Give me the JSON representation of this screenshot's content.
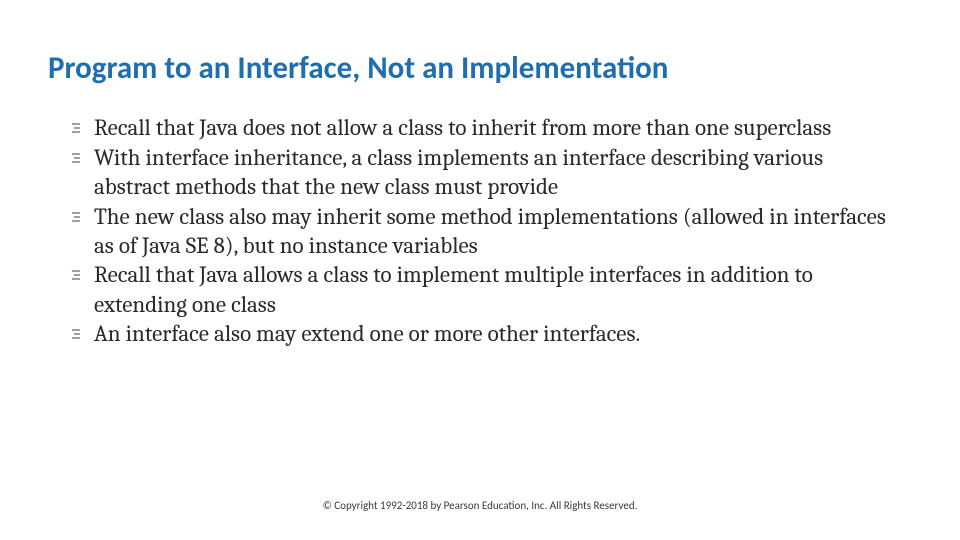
{
  "title": "Program to an Interface, Not an Implementation",
  "bullets": {
    "b0": "Recall that Java does not allow a class to inherit from more than one superclass",
    "b1": "With interface inheritance, a class implements an interface describing various abstract methods that the new class must provide",
    "b2": "The new class also may inherit some method implementations (allowed in interfaces as of Java SE 8), but no instance variables",
    "b3": "Recall that Java allows a class to implement multiple interfaces in addition to extending one class",
    "b4": "An interface also may extend one or more other interfaces."
  },
  "footer": "© Copyright 1992-2018 by Pearson Education, Inc. All Rights Reserved."
}
